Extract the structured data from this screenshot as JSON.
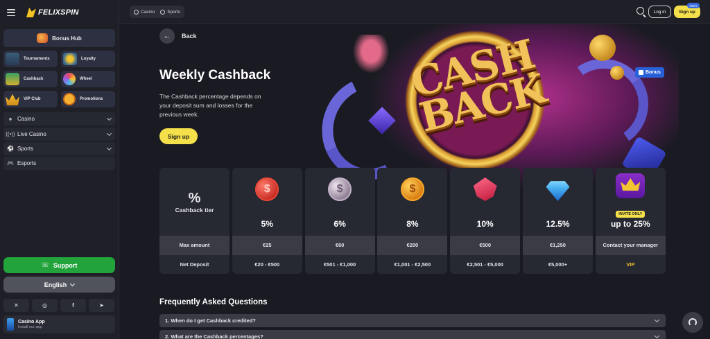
{
  "brand": {
    "name": "FELIXSPIN"
  },
  "sidebar": {
    "bonus_hub": "Bonus Hub",
    "tiles": [
      {
        "label": "Tournaments",
        "icon": "trophy-icon"
      },
      {
        "label": "Loyalty",
        "icon": "shield-icon"
      },
      {
        "label": "Cashback",
        "icon": "cash-icon"
      },
      {
        "label": "Wheel",
        "icon": "wheel-icon"
      },
      {
        "label": "VIP Club",
        "icon": "crown-icon"
      },
      {
        "label": "Promotions",
        "icon": "percent-icon"
      }
    ],
    "nav": [
      {
        "label": "Casino",
        "icon": "cards-icon",
        "expandable": true
      },
      {
        "label": "Live Casino",
        "icon": "live-icon",
        "expandable": true
      },
      {
        "label": "Sports",
        "icon": "ball-icon",
        "expandable": true
      },
      {
        "label": "Esports",
        "icon": "gamepad-icon",
        "expandable": false
      }
    ],
    "support": "Support",
    "language": "English",
    "socials": [
      "x-icon",
      "instagram-icon",
      "facebook-icon",
      "telegram-icon"
    ],
    "app": {
      "title": "Casino App",
      "subtitle": "Install our app"
    }
  },
  "topbar": {
    "switch": [
      "Casino",
      "Sports"
    ],
    "login": "Log in",
    "signup": "Sign up",
    "signup_badge": "100%"
  },
  "main": {
    "back": "Back",
    "title": "Weekly Cashback",
    "description": "The Cashback percentage depends on your deposit sum and losses for the previous week.",
    "signup": "Sign up",
    "bonus_tag": "Bonus",
    "hero_text": "CASH BACK",
    "tier_header": {
      "symbol": "%",
      "label": "Cashback tier",
      "max_amount": "Max amount",
      "net_deposit": "Net Deposit"
    },
    "tiers": [
      {
        "icon": "red-coin-icon",
        "percent": "5%",
        "max_amount": "€25",
        "net_deposit": "€20 - €500"
      },
      {
        "icon": "silver-coin-icon",
        "percent": "6%",
        "max_amount": "€60",
        "net_deposit": "€501 - €1,000"
      },
      {
        "icon": "gold-coin-icon",
        "percent": "8%",
        "max_amount": "€200",
        "net_deposit": "€1,001 - €2,500"
      },
      {
        "icon": "ruby-icon",
        "percent": "10%",
        "max_amount": "€500",
        "net_deposit": "€2,501 - €5,000"
      },
      {
        "icon": "diamond-icon",
        "percent": "12.5%",
        "max_amount": "€1,250",
        "net_deposit": "€5,000+"
      },
      {
        "icon": "crown-icon",
        "badge": "INVITE ONLY",
        "percent": "up to 25%",
        "max_amount": "Contact your manager",
        "net_deposit": "VIP"
      }
    ],
    "faq_title": "Frequently Asked Questions",
    "faq": [
      "1.  When do I get Cashback credited?",
      "2.  What are the Cashback percentages?"
    ]
  },
  "colors": {
    "accent_yellow": "#f4e04a",
    "support_green": "#23a33b",
    "bonus_blue": "#2860d8"
  }
}
